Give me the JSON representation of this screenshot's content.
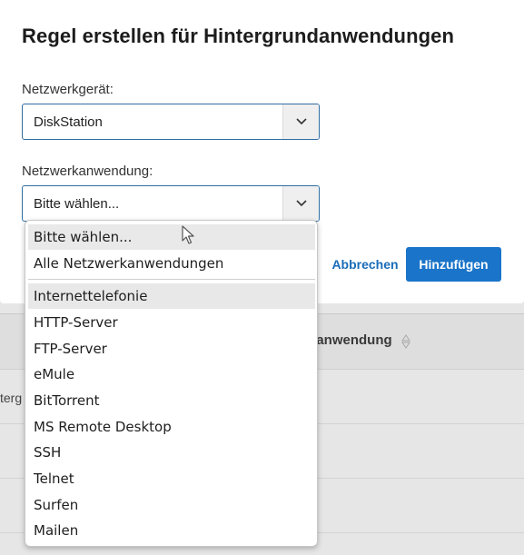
{
  "background": {
    "column_header": "kanwendung",
    "cell_fragment": "terg"
  },
  "modal": {
    "title": "Regel erstellen für Hintergrundanwendungen",
    "device_label": "Netzwerkgerät:",
    "device_value": "DiskStation",
    "app_label": "Netzwerkanwendung:",
    "app_value": "Bitte wählen...",
    "cancel_label": "Abbrechen",
    "add_label": "Hinzufügen"
  },
  "dropdown": {
    "items_top": [
      "Bitte wählen...",
      "Alle Netzwerkanwendungen"
    ],
    "items": [
      "Internettelefonie",
      "HTTP-Server",
      "FTP-Server",
      "eMule",
      "BitTorrent",
      "MS Remote Desktop",
      "SSH",
      "Telnet",
      "Surfen",
      "Mailen"
    ]
  },
  "colors": {
    "accent": "#1a74c9",
    "link": "#1a6cb8",
    "border_focus": "#2e6da4"
  },
  "icons": {
    "chevron": "chevron-down-icon",
    "sort": "sort-icon",
    "cursor": "mouse-pointer-icon"
  }
}
